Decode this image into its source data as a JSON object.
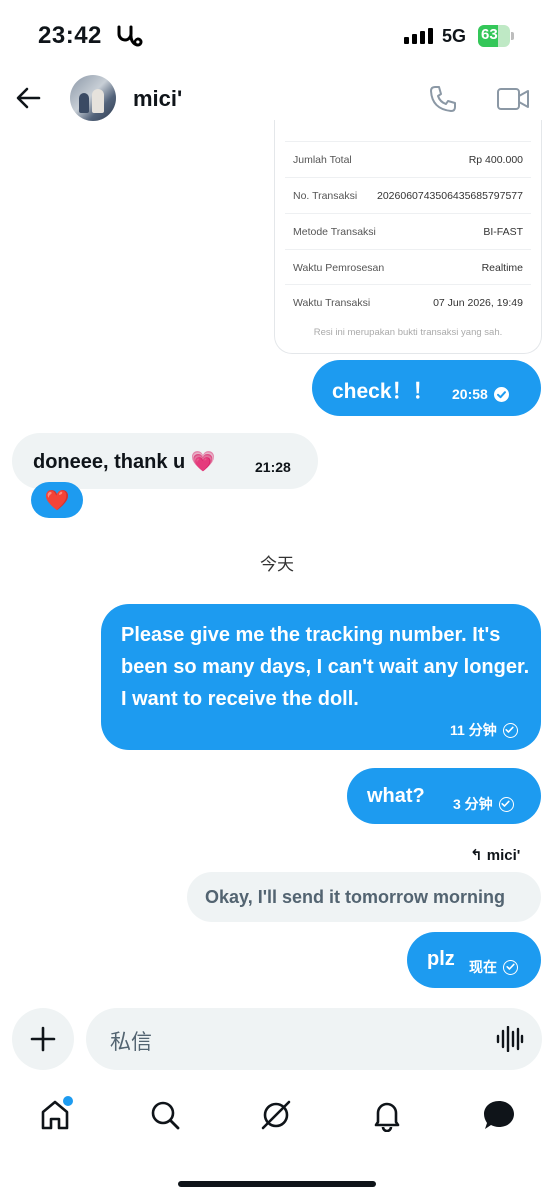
{
  "status_bar": {
    "time": "23:42",
    "network": "5G",
    "battery": "63"
  },
  "header": {
    "username": "mici'"
  },
  "receipt": {
    "rows": [
      {
        "label": "Jumlah Total",
        "value": "Rp 400.000"
      },
      {
        "label": "No. Transaksi",
        "value": "20260607435064356857975​77"
      },
      {
        "label": "Metode Transaksi",
        "value": "BI-FAST"
      },
      {
        "label": "Waktu Pemrosesan",
        "value": "Realtime"
      },
      {
        "label": "Waktu Transaksi",
        "value": "07 Jun 2026, 19:49"
      }
    ],
    "footer": "Resi ini merupakan bukti transaksi yang sah."
  },
  "messages": [
    {
      "text": "check！！",
      "time": "20:58"
    },
    {
      "text": "doneee, thank u 💗",
      "time": "21:28",
      "reaction": "❤️"
    },
    {
      "day": "今天"
    },
    {
      "text": "Please give me the tracking number. It's been so many days, I can't wait any longer. I want to receive the doll.",
      "time": "11 分钟"
    },
    {
      "text": "what?",
      "time": "3 分钟"
    },
    {
      "reply_to": "mici'",
      "text": "Okay, I'll send it tomorrow morning"
    },
    {
      "text": "plz",
      "time": "现在"
    }
  ],
  "composer": {
    "placeholder": "私信"
  },
  "colors": {
    "accent": "#1d9bf0",
    "received_bubble": "#eff3f4"
  },
  "tabbar": [
    "home-icon",
    "search-icon",
    "grok-icon",
    "notifications-icon",
    "messages-icon"
  ]
}
